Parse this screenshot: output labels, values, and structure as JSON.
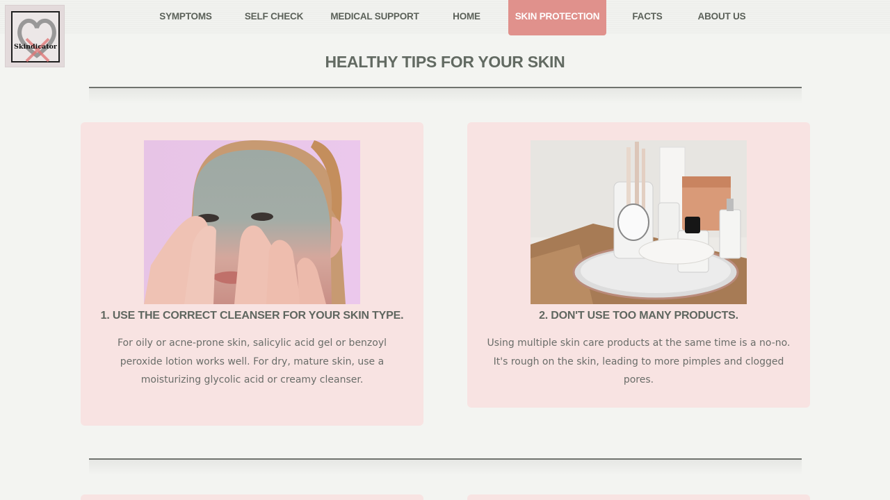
{
  "logo": {
    "text": "Skindicator",
    "icon": "heart-x-logo-icon"
  },
  "nav": {
    "items": [
      {
        "label": "SYMPTOMS",
        "active": false
      },
      {
        "label": "SELF CHECK",
        "active": false
      },
      {
        "label": "MEDICAL SUPPORT",
        "active": false
      },
      {
        "label": "HOME",
        "active": false
      },
      {
        "label": "SKIN PROTECTION",
        "active": true
      },
      {
        "label": "FACTS",
        "active": false
      },
      {
        "label": "ABOUT US",
        "active": false
      }
    ]
  },
  "page": {
    "title": "HEALTHY TIPS FOR YOUR SKIN"
  },
  "cards": [
    {
      "title": "1. USE THE CORRECT CLEANSER FOR YOUR SKIN TYPE.",
      "text": "For oily or acne-prone skin, salicylic acid gel or benzoyl peroxide lotion works well. For dry, mature skin, use a moisturizing glycolic acid or creamy cleanser.",
      "image": "man-applying-face-mask-photo"
    },
    {
      "title": "2. DON'T USE TOO MANY PRODUCTS.",
      "text": "Using multiple skin care products at the same time is a no-no. It's rough on the skin, leading to more pimples and clogged pores.",
      "image": "skincare-products-tray-photo"
    }
  ],
  "colors": {
    "background": "#f3f4f1",
    "card": "#f8e3e2",
    "active_nav": "#e0918c",
    "text": "#5b6159"
  }
}
